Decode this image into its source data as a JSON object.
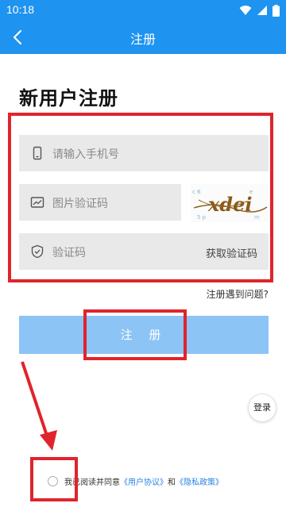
{
  "status_bar": {
    "time": "10:18"
  },
  "nav": {
    "title": "注册"
  },
  "page": {
    "title": "新用户注册"
  },
  "form": {
    "phone_placeholder": "请输入手机号",
    "image_code_placeholder": "图片验证码",
    "captcha_text": "xdei",
    "sms_code_placeholder": "验证码",
    "get_code_label": "获取验证码"
  },
  "problem_link": "注册遇到问题?",
  "register_button": "注 册",
  "login_button": "登录",
  "agreement": {
    "prefix": "我已阅读并同意",
    "user_agreement": "《用户协议》",
    "and": "和",
    "privacy_policy": "《隐私政策》"
  },
  "colors": {
    "primary": "#1e93f0",
    "button_disabled": "#8cc4f5",
    "annotation_red": "#e0242b",
    "link": "#2a82e4",
    "field_bg": "#e9e9e9"
  },
  "icons": [
    "wifi-icon",
    "signal-icon",
    "battery-icon",
    "back-arrow-icon",
    "phone-icon",
    "image-icon",
    "shield-icon",
    "radio-icon"
  ]
}
